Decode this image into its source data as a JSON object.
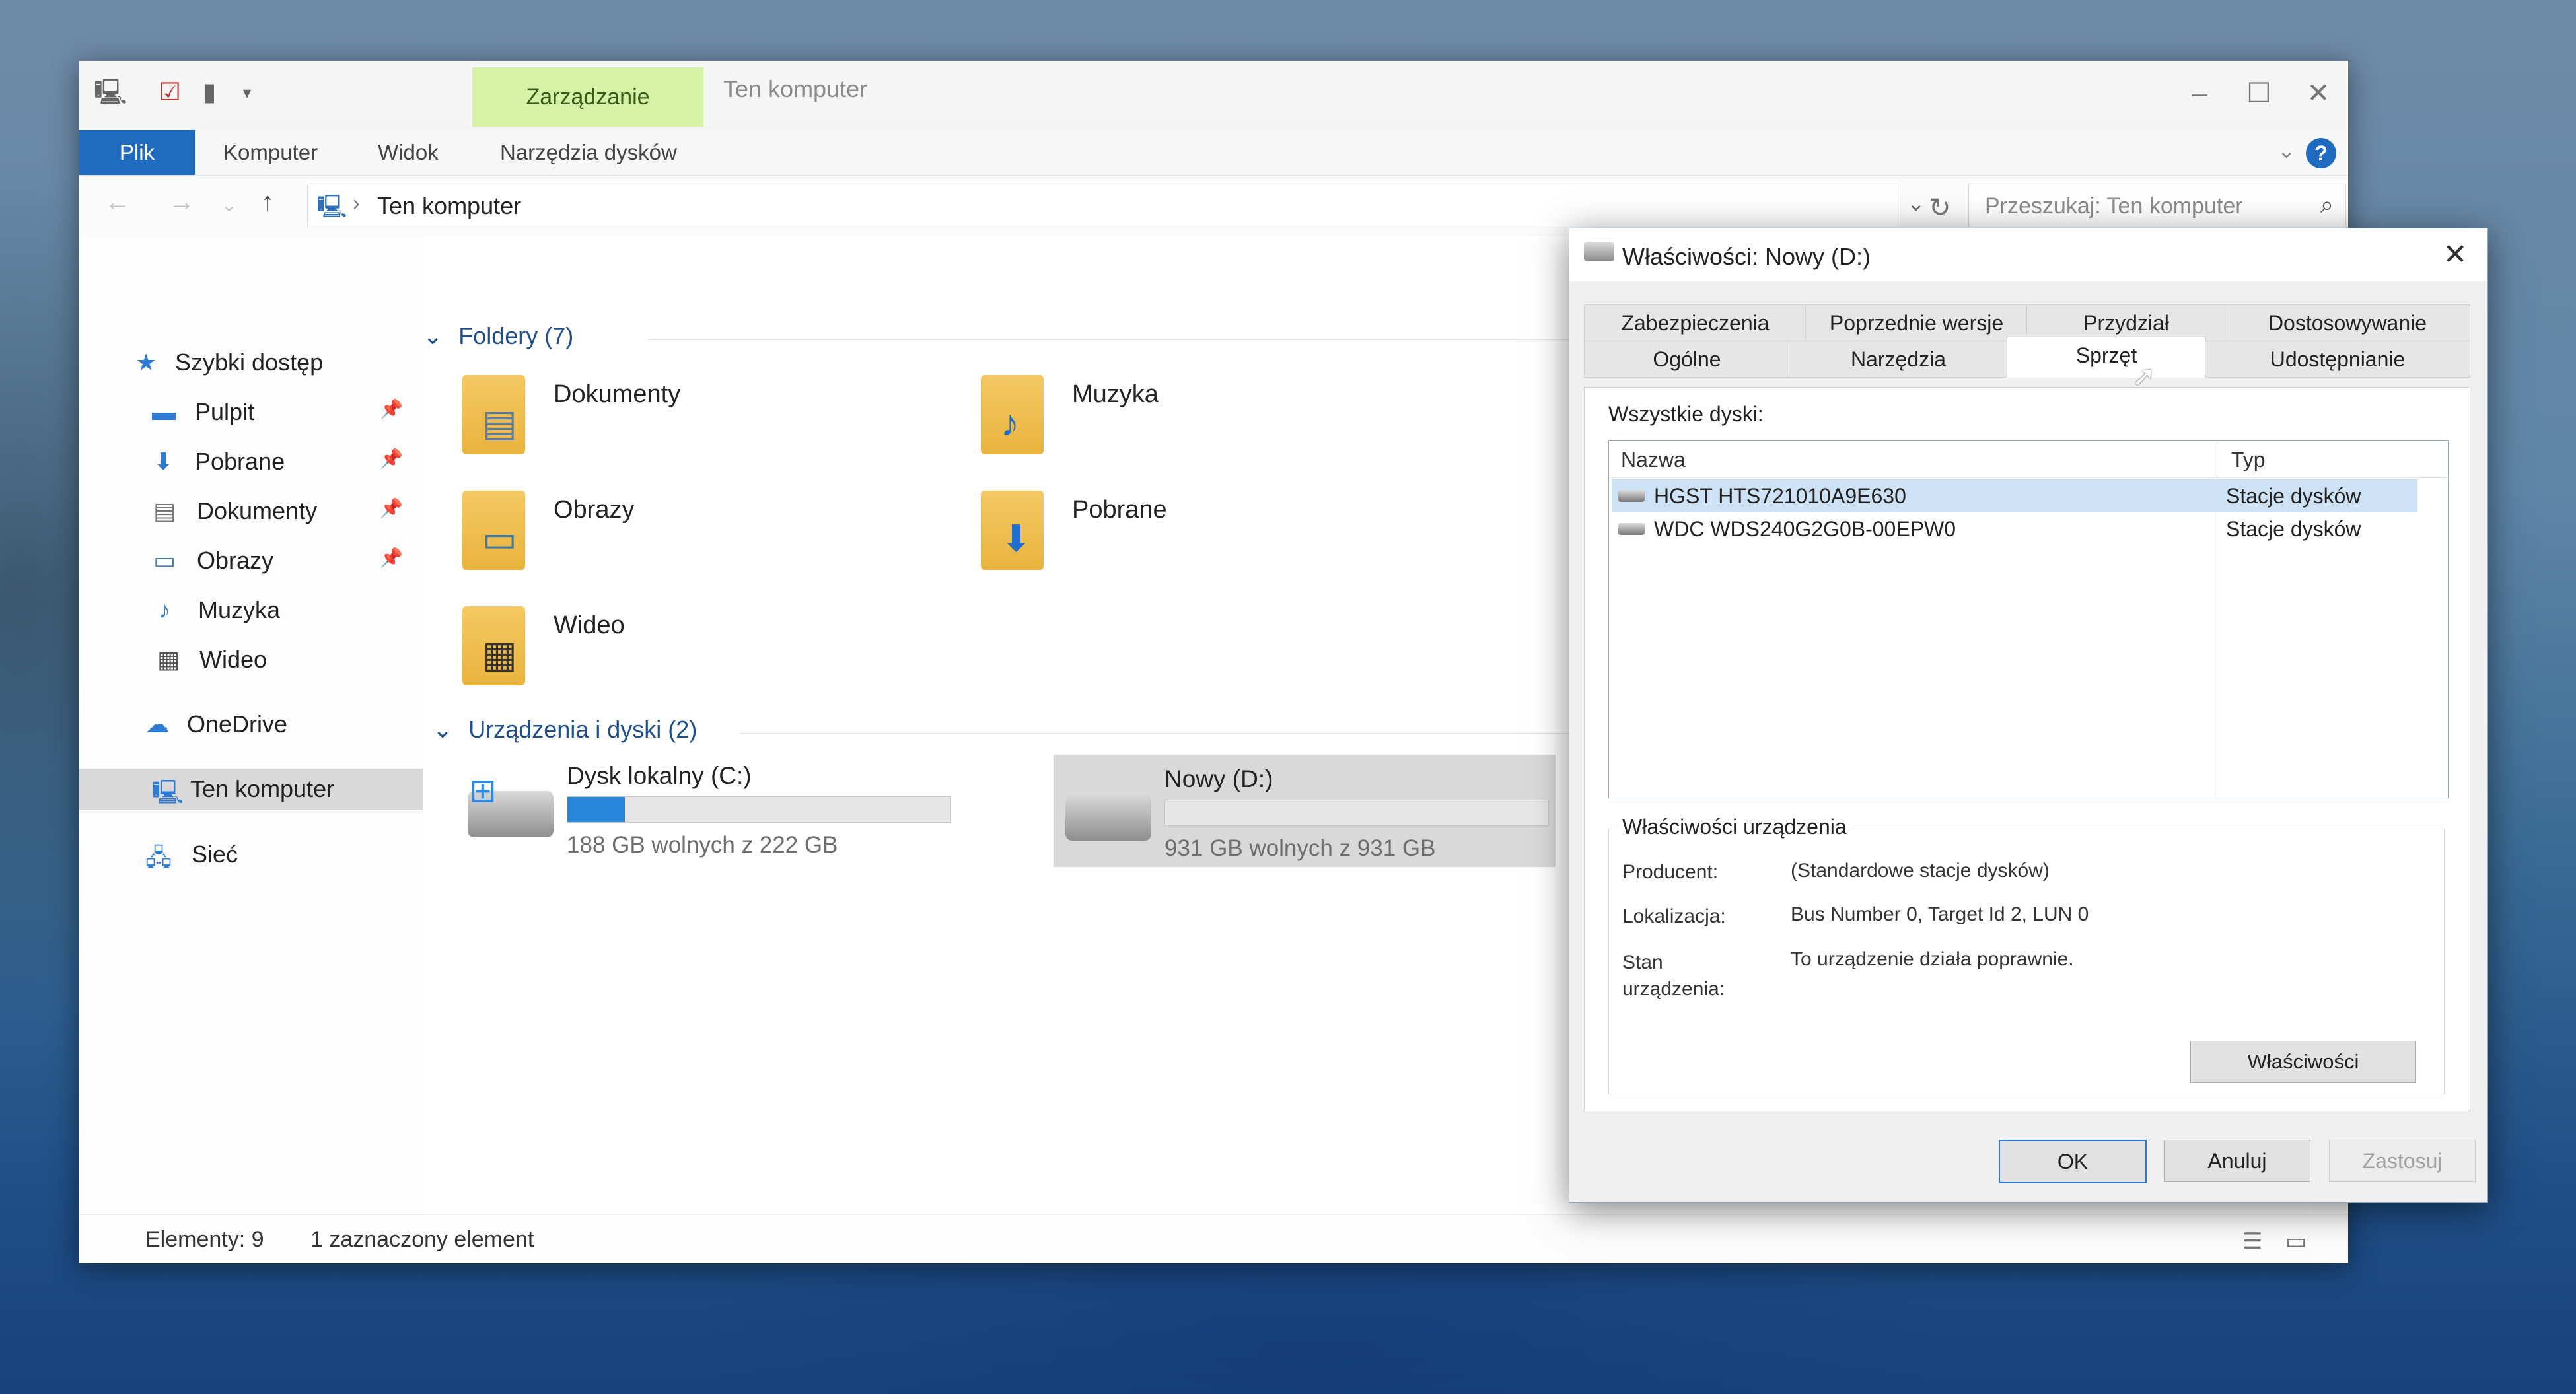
{
  "explorer": {
    "title": "Ten komputer",
    "context_tab": "Zarządzanie",
    "ribbon_tabs": [
      "Plik",
      "Komputer",
      "Widok",
      "Narzędzia dysków"
    ],
    "address": "Ten komputer",
    "search_placeholder": "Przeszukaj: Ten komputer",
    "sidebar": [
      {
        "label": "Szybki dostęp",
        "icon": "star-icon"
      },
      {
        "label": "Pulpit",
        "icon": "desktop-icon",
        "pinned": true
      },
      {
        "label": "Pobrane",
        "icon": "download-icon",
        "pinned": true
      },
      {
        "label": "Dokumenty",
        "icon": "document-icon",
        "pinned": true
      },
      {
        "label": "Obrazy",
        "icon": "picture-icon",
        "pinned": true
      },
      {
        "label": "Muzyka",
        "icon": "music-icon"
      },
      {
        "label": "Wideo",
        "icon": "video-icon"
      },
      {
        "label": "OneDrive",
        "icon": "cloud-icon"
      },
      {
        "label": "Ten komputer",
        "icon": "computer-icon",
        "selected": true
      },
      {
        "label": "Sieć",
        "icon": "network-icon"
      }
    ],
    "folders_header": "Foldery (7)",
    "folders": [
      {
        "name": "Dokumenty",
        "icon": "documents-folder-icon"
      },
      {
        "name": "Muzyka",
        "icon": "music-folder-icon"
      },
      {
        "name": "Obrazy",
        "icon": "pictures-folder-icon"
      },
      {
        "name": "Pobrane",
        "icon": "downloads-folder-icon"
      },
      {
        "name": "Wideo",
        "icon": "videos-folder-icon"
      }
    ],
    "devices_header": "Urządzenia i dyski (2)",
    "drives": [
      {
        "name": "Dysk lokalny (C:)",
        "free": "188 GB wolnych z 222 GB",
        "used_fraction": 0.15,
        "selected": false
      },
      {
        "name": "Nowy (D:)",
        "free": "931 GB wolnych z 931 GB",
        "used_fraction": 0.0,
        "selected": true
      }
    ],
    "status": {
      "items": "Elementy: 9",
      "selected": "1 zaznaczony element"
    }
  },
  "dialog": {
    "title": "Właściwości: Nowy (D:)",
    "tabs_top": [
      "Zabezpieczenia",
      "Poprzednie wersje",
      "Przydział",
      "Dostosowywanie"
    ],
    "tabs_bottom": [
      "Ogólne",
      "Narzędzia",
      "Sprzęt",
      "Udostępnianie"
    ],
    "active_tab": "Sprzęt",
    "all_disks_label": "Wszystkie dyski:",
    "columns": [
      "Nazwa",
      "Typ"
    ],
    "disks": [
      {
        "name": "HGST HTS721010A9E630",
        "type": "Stacje dysków",
        "selected": true
      },
      {
        "name": "WDC WDS240G2G0B-00EPW0",
        "type": "Stacje dysków",
        "selected": false
      }
    ],
    "device_props_label": "Właściwości urządzenia",
    "props": [
      {
        "key": "Producent:",
        "value": "(Standardowe stacje dysków)"
      },
      {
        "key": "Lokalizacja:",
        "value": "Bus Number 0, Target Id 2, LUN 0"
      },
      {
        "key": "Stan urządzenia:",
        "value": "To urządzenie działa poprawnie."
      }
    ],
    "props_button": "Właściwości",
    "buttons": {
      "ok": "OK",
      "cancel": "Anuluj",
      "apply": "Zastosuj"
    }
  },
  "colors": {
    "accent": "#1f6bbf",
    "context_tab": "#d6f2a6",
    "drive_fill": "#2686d9",
    "selection": "#cde3f5"
  }
}
